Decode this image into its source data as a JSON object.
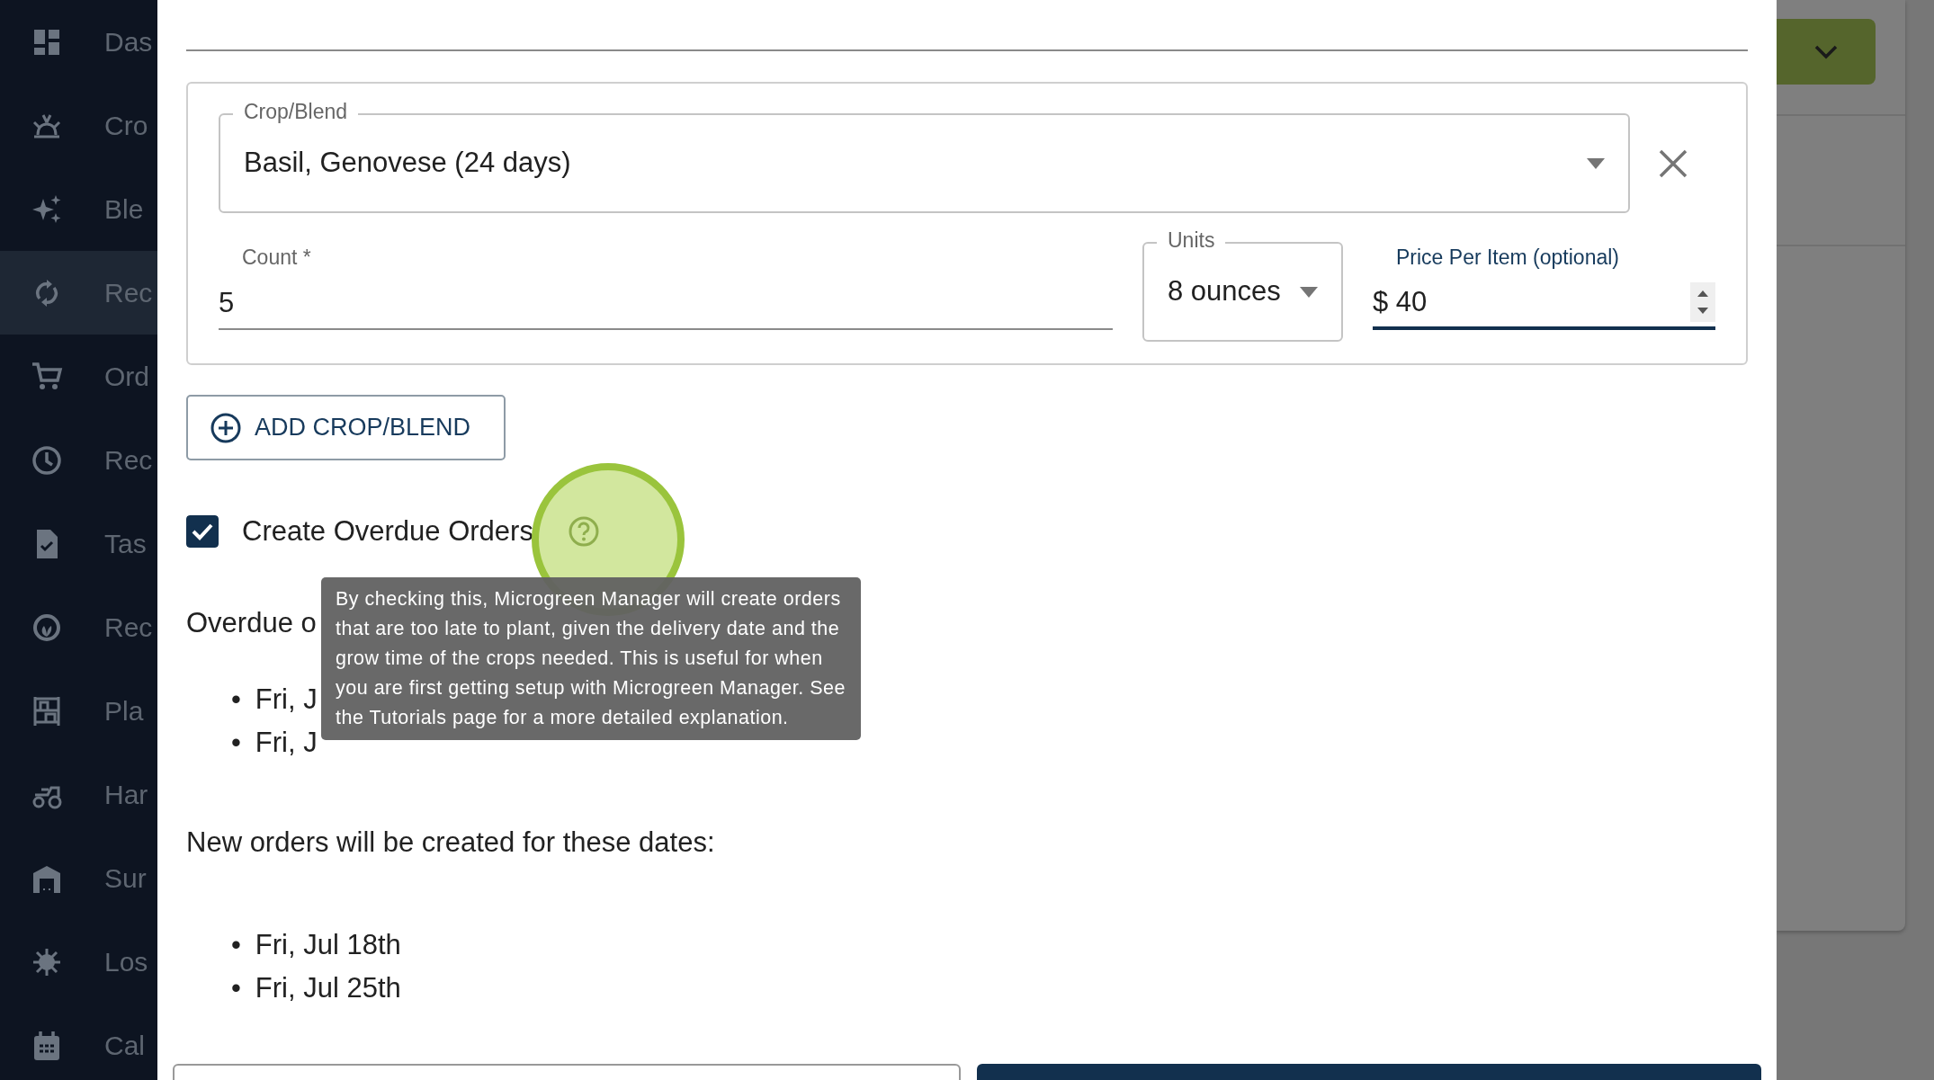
{
  "sidebar": {
    "items": [
      {
        "label": "Das",
        "selected": false
      },
      {
        "label": "Cro",
        "selected": false
      },
      {
        "label": "Ble",
        "selected": false
      },
      {
        "label": "Rec",
        "selected": true
      },
      {
        "label": "Ord",
        "selected": false
      },
      {
        "label": "Rec",
        "selected": false
      },
      {
        "label": "Tas",
        "selected": false
      },
      {
        "label": "Rec",
        "selected": false
      },
      {
        "label": "Pla",
        "selected": false
      },
      {
        "label": "Har",
        "selected": false
      },
      {
        "label": "Sur",
        "selected": false
      },
      {
        "label": "Los",
        "selected": false
      },
      {
        "label": "Cal",
        "selected": false
      }
    ]
  },
  "modal": {
    "crop_blend": {
      "label": "Crop/Blend",
      "value": "Basil, Genovese (24 days)"
    },
    "count": {
      "label": "Count",
      "required_mark": "*",
      "value": "5"
    },
    "units": {
      "label": "Units",
      "value": "8 ounces"
    },
    "price": {
      "label": "Price Per Item (optional)",
      "prefix": "$",
      "value": "40",
      "focused": true
    },
    "add_button": "ADD CROP/BLEND",
    "overdue_checkbox": {
      "label": "Create Overdue Orders",
      "checked": true
    },
    "tooltip": "By checking this, Microgreen Manager will create orders that are too late to plant, given the delivery date and the grow time of the crops needed. This is useful for when you are first getting setup with Microgreen Manager. See the Tutorials page for a more detailed explanation.",
    "overdue_heading": "Overdue o",
    "overdue_dates": [
      {
        "marker": "•",
        "text": "Fri, J"
      },
      {
        "marker": "•",
        "text": "Fri, J"
      }
    ],
    "new_heading": "New orders will be created for these dates:",
    "new_dates": [
      {
        "marker": "•",
        "text": "Fri, Jul 18th"
      },
      {
        "marker": "•",
        "text": "Fri, Jul 25th"
      }
    ]
  }
}
